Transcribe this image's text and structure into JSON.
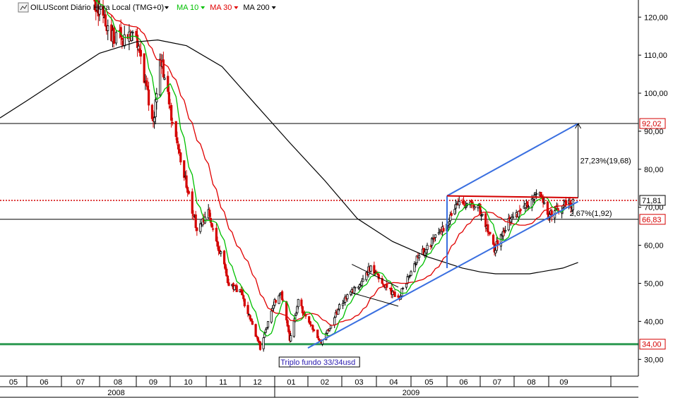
{
  "legend": {
    "symbol": "OILUScont Diário Hora Local (TMG+0)",
    "ma_items": [
      {
        "label": "MA 10",
        "color": "#00c000"
      },
      {
        "label": "MA 30",
        "color": "#e00000"
      },
      {
        "label": "MA 200",
        "color": "#000000"
      }
    ]
  },
  "colors": {
    "up_candle": "#000000",
    "down_candle": "#d40000",
    "trendline": "#3a6fe0",
    "support": "#2e9a52",
    "resistance_dotted": "#d40000",
    "price_label_red": "#d40000"
  },
  "chart_data": {
    "type": "candlestick",
    "instrument": "OILUScont",
    "timeframe": "Diário",
    "y_axis": {
      "ylim": [
        25.6,
        124.5
      ],
      "ticks": [
        "30,00",
        "40,00",
        "50,00",
        "60,00",
        "70,00",
        "80,00",
        "90,00",
        "100,00",
        "110,00",
        "120,00"
      ],
      "side": "right"
    },
    "x_axis": {
      "months": [
        {
          "label": "05",
          "date": "2008-05-01"
        },
        {
          "label": "06",
          "date": "2008-06-01"
        },
        {
          "label": "07",
          "date": "2008-07-01"
        },
        {
          "label": "08",
          "date": "2008-08-01"
        },
        {
          "label": "09",
          "date": "2008-09-01"
        },
        {
          "label": "10",
          "date": "2008-10-01"
        },
        {
          "label": "11",
          "date": "2008-11-01"
        },
        {
          "label": "12",
          "date": "2008-12-01"
        },
        {
          "label": "01",
          "date": "2009-01-01"
        },
        {
          "label": "02",
          "date": "2009-02-01"
        },
        {
          "label": "03",
          "date": "2009-03-01"
        },
        {
          "label": "04",
          "date": "2009-04-01"
        },
        {
          "label": "05",
          "date": "2009-05-01"
        },
        {
          "label": "06",
          "date": "2009-06-01"
        },
        {
          "label": "07",
          "date": "2009-07-01"
        },
        {
          "label": "08",
          "date": "2009-08-01"
        },
        {
          "label": "09",
          "date": "2009-09-01"
        }
      ],
      "years": [
        {
          "label": "2008",
          "date": "2008-08-15"
        },
        {
          "label": "2009",
          "date": "2009-05-01"
        }
      ],
      "year_boundary": "2009-01-01"
    },
    "price_path": [
      [
        "2008-07-25",
        126
      ],
      [
        "2008-08-12",
        115
      ],
      [
        "2008-09-01",
        114
      ],
      [
        "2008-09-16",
        92
      ],
      [
        "2008-09-22",
        110
      ],
      [
        "2008-10-06",
        88
      ],
      [
        "2008-10-24",
        64
      ],
      [
        "2008-11-03",
        69
      ],
      [
        "2008-11-21",
        50
      ],
      [
        "2008-12-01",
        48
      ],
      [
        "2008-12-19",
        33
      ],
      [
        "2008-12-31",
        44.5
      ],
      [
        "2009-01-07",
        48
      ],
      [
        "2009-01-15",
        35
      ],
      [
        "2009-01-23",
        45
      ],
      [
        "2009-02-12",
        34
      ],
      [
        "2009-03-01",
        45
      ],
      [
        "2009-03-18",
        50
      ],
      [
        "2009-03-26",
        54
      ],
      [
        "2009-04-20",
        46
      ],
      [
        "2009-05-05",
        56
      ],
      [
        "2009-05-30",
        65
      ],
      [
        "2009-06-11",
        72
      ],
      [
        "2009-06-30",
        70
      ],
      [
        "2009-07-14",
        59
      ],
      [
        "2009-07-28",
        67
      ],
      [
        "2009-08-10",
        70
      ],
      [
        "2009-08-24",
        74
      ],
      [
        "2009-09-02",
        68
      ],
      [
        "2009-09-14",
        70
      ],
      [
        "2009-09-25",
        71
      ]
    ],
    "ma200": [
      [
        "2008-05-01",
        93.5
      ],
      [
        "2008-06-01",
        98
      ],
      [
        "2008-07-01",
        104
      ],
      [
        "2008-08-01",
        110.5
      ],
      [
        "2008-09-01",
        113.5
      ],
      [
        "2008-09-20",
        114
      ],
      [
        "2008-10-15",
        112.5
      ],
      [
        "2008-11-15",
        107
      ],
      [
        "2008-12-15",
        97
      ],
      [
        "2009-01-15",
        87
      ],
      [
        "2009-02-15",
        77
      ],
      [
        "2009-03-15",
        67
      ],
      [
        "2009-04-15",
        61
      ],
      [
        "2009-05-15",
        57
      ],
      [
        "2009-06-15",
        54
      ],
      [
        "2009-07-01",
        53
      ],
      [
        "2009-07-15",
        52.5
      ],
      [
        "2009-08-15",
        52.5
      ],
      [
        "2009-09-15",
        54
      ],
      [
        "2009-09-30",
        55.5
      ]
    ],
    "horizontal_lines": [
      {
        "value": 92.02,
        "label": "92,02",
        "style": "solid",
        "color": "#000000",
        "label_color": "#d40000"
      },
      {
        "value": 71.81,
        "label": "71,81",
        "style": "dotted",
        "color": "#d40000",
        "label_color": "#000000"
      },
      {
        "value": 66.83,
        "label": "66,83",
        "style": "solid",
        "color": "#000000",
        "label_color": "#d40000"
      },
      {
        "value": 34.0,
        "label": "34,00",
        "style": "solid-thick",
        "color": "#2e9a52",
        "label_color": "#d40000"
      }
    ],
    "trendlines": [
      {
        "from": [
          "2009-02-01",
          33
        ],
        "to": [
          "2009-09-30",
          71.5
        ],
        "color": "#3a6fe0"
      },
      {
        "from": [
          "2009-06-01",
          73
        ],
        "to": [
          "2009-09-30",
          92
        ],
        "color": "#3a6fe0"
      },
      {
        "from": [
          "2009-06-01",
          54
        ],
        "to": [
          "2009-06-01",
          73
        ],
        "color": "#3a6fe0"
      },
      {
        "from": [
          "2009-06-01",
          73
        ],
        "to": [
          "2009-09-30",
          72.5
        ],
        "color": "#d40000"
      },
      {
        "from": [
          "2009-03-10",
          55
        ],
        "to": [
          "2009-04-20",
          49
        ],
        "color": "#000000"
      },
      {
        "from": [
          "2009-03-10",
          47.5
        ],
        "to": [
          "2009-04-20",
          44
        ],
        "color": "#000000"
      }
    ],
    "annotations": {
      "big_measure": {
        "label": "27,23%(19,68)",
        "from": 72.5,
        "to": 92.02,
        "date": "2009-09-30"
      },
      "small_measure": {
        "label": "2,67%(1,92)",
        "value": 69.6
      },
      "triple_bottom": {
        "label": "Triplo fundo 33/34usd",
        "date": "2009-01-15"
      }
    }
  }
}
